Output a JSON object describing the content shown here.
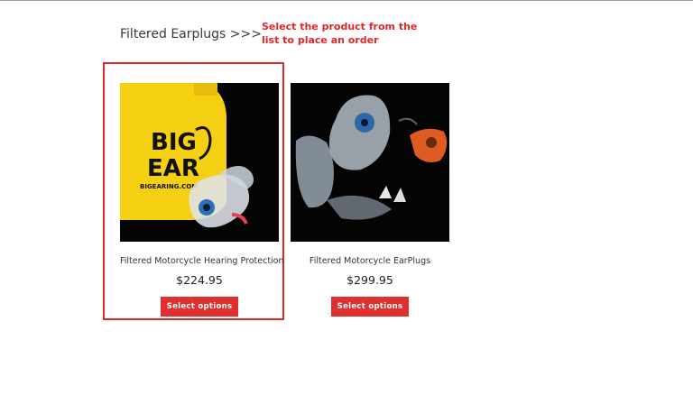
{
  "section": {
    "title": "Filtered Earplugs >>>"
  },
  "annotation": {
    "text": "Select the product from the list to place an order"
  },
  "products": [
    {
      "name": "Filtered Motorcycle Hearing Protection",
      "price": "$224.95",
      "button_label": "Select options",
      "image_logo_text": [
        "BIG",
        "EAR",
        "BIGEARING.COM"
      ]
    },
    {
      "name": "Filtered Motorcycle EarPlugs",
      "price": "$299.95",
      "button_label": "Select options"
    }
  ],
  "colors": {
    "accent": "#e02f2f",
    "annotation": "#e02727",
    "case_yellow": "#f5cf12"
  }
}
